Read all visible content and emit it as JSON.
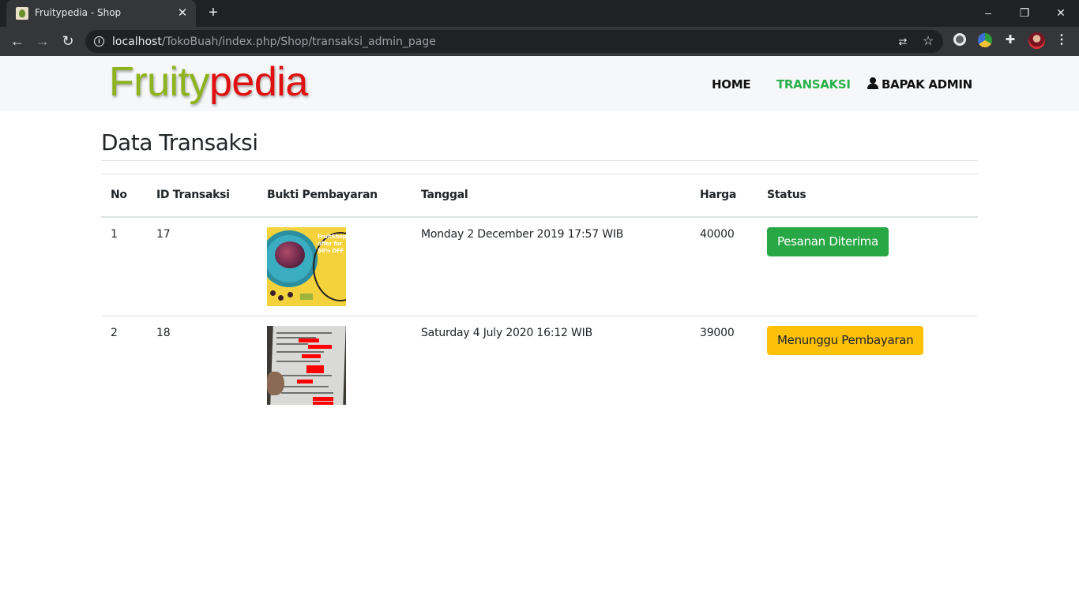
{
  "browser": {
    "tab_title": "Fruitypedia - Shop",
    "url_host": "localhost",
    "url_path": "/TokoBuah/index.php/Shop/transaksi_admin_page"
  },
  "navbar": {
    "brand_part1": "Fruity",
    "brand_part2": "pedia",
    "links": [
      {
        "label": "HOME"
      },
      {
        "label": "TRANSAKSI"
      },
      {
        "label": "BAPAK ADMIN"
      }
    ]
  },
  "main": {
    "title": "Data Transaksi",
    "columns": [
      "No",
      "ID Transaksi",
      "Bukti Pembayaran",
      "Tanggal",
      "Harga",
      "Status"
    ],
    "rows": [
      {
        "no": "1",
        "id": "17",
        "tanggal": "Monday 2 December 2019 17:57 WIB",
        "harga": "40000",
        "status": "Pesanan Diterima"
      },
      {
        "no": "2",
        "id": "18",
        "tanggal": "Saturday 4 July 2020 16:12 WIB",
        "harga": "39000",
        "status": "Menunggu Pembayaran"
      }
    ],
    "thumb1_text": [
      "FruitShop",
      "offer for",
      "50% OFF"
    ]
  },
  "colors": {
    "brand_green": "#8db41e",
    "brand_red": "#e01010",
    "active_nav": "#28b04a",
    "success": "#28a745",
    "warning": "#ffc107"
  }
}
